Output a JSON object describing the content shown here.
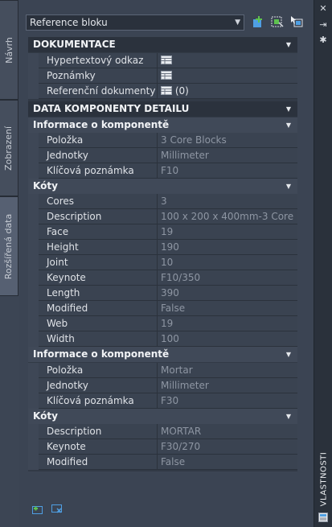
{
  "side_tabs": {
    "navrh": "Návrh",
    "zobrazeni": "Zobrazení",
    "rozsirena": "Rozšířená data"
  },
  "palette_title": "VLASTNOSTI",
  "dropdown": {
    "value": "Reference bloku"
  },
  "sections": {
    "dokumentace": {
      "title": "DOKUMENTACE",
      "rows": [
        {
          "label": "Hypertextový odkaz",
          "value": ""
        },
        {
          "label": "Poznámky",
          "value": ""
        },
        {
          "label": "Referenční dokumenty",
          "value": "(0)"
        }
      ]
    },
    "data_komponenty": {
      "title": "DATA KOMPONENTY DETAILU"
    },
    "info1": {
      "title": "Informace o komponentě",
      "rows": [
        {
          "label": "Položka",
          "value": "3 Core Blocks"
        },
        {
          "label": "Jednotky",
          "value": "Millimeter"
        },
        {
          "label": "Klíčová poznámka",
          "value": "F10"
        }
      ]
    },
    "koty1": {
      "title": "Kóty",
      "rows": [
        {
          "label": "Cores",
          "value": "3"
        },
        {
          "label": "Description",
          "value": "100 x 200 x 400mm-3 Core"
        },
        {
          "label": "Face",
          "value": "19"
        },
        {
          "label": "Height",
          "value": "190"
        },
        {
          "label": "Joint",
          "value": "10"
        },
        {
          "label": "Keynote",
          "value": "F10/350"
        },
        {
          "label": "Length",
          "value": "390"
        },
        {
          "label": "Modified",
          "value": "False"
        },
        {
          "label": "Web",
          "value": "19"
        },
        {
          "label": "Width",
          "value": "100"
        }
      ]
    },
    "info2": {
      "title": "Informace o komponentě",
      "rows": [
        {
          "label": "Položka",
          "value": "Mortar"
        },
        {
          "label": "Jednotky",
          "value": "Millimeter"
        },
        {
          "label": "Klíčová poznámka",
          "value": "F30"
        }
      ]
    },
    "koty2": {
      "title": "Kóty",
      "rows": [
        {
          "label": "Description",
          "value": "MORTAR"
        },
        {
          "label": "Keynote",
          "value": "F30/270"
        },
        {
          "label": "Modified",
          "value": "False"
        }
      ]
    }
  },
  "icons": {
    "add_selection": "add-to-selection-icon",
    "quick_select": "quick-select-icon",
    "select_objects": "select-objects-icon",
    "close": "close-icon",
    "pin": "auto-hide-icon",
    "settings": "settings-icon",
    "table": "table-icon"
  },
  "colors": {
    "accent_green": "#5ec24f",
    "accent_blue": "#4f9fe3"
  }
}
